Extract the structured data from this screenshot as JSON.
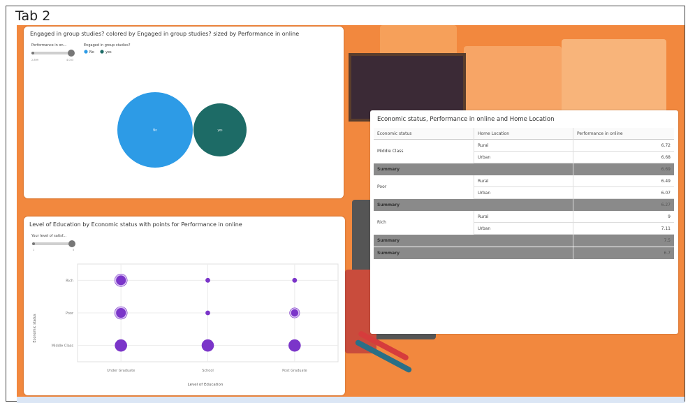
{
  "tab": {
    "title": "Tab 2"
  },
  "bubble_card": {
    "title": "Engaged in group studies? colored by Engaged in group studies? sized by Performance in online",
    "slider_label": "Performance in on...",
    "slider_min": "2.899",
    "slider_max": "4.033",
    "legend_title": "Engaged in group studies?",
    "legend": [
      {
        "label": "No",
        "color": "#2d9be6"
      },
      {
        "label": "yes",
        "color": "#1d6b66"
      }
    ],
    "bubbles": [
      {
        "label": "No",
        "color": "#2d9be6"
      },
      {
        "label": "yes",
        "color": "#1d6b66"
      }
    ]
  },
  "table_card": {
    "title": "Economic status, Performance in online and Home Location",
    "headers": [
      "Economic status",
      "Home Location",
      "Performance in online"
    ],
    "groups": [
      {
        "status": "Middle Class",
        "rows": [
          {
            "loc": "Rural",
            "val": "6.72"
          },
          {
            "loc": "Urban",
            "val": "6.68"
          }
        ],
        "summary_label": "Summary",
        "summary_val": "6.69"
      },
      {
        "status": "Poor",
        "rows": [
          {
            "loc": "Rural",
            "val": "6.49"
          },
          {
            "loc": "Urban",
            "val": "6.07"
          }
        ],
        "summary_label": "Summary",
        "summary_val": "6.27"
      },
      {
        "status": "Rich",
        "rows": [
          {
            "loc": "Rural",
            "val": "9"
          },
          {
            "loc": "Urban",
            "val": "7.11"
          }
        ],
        "summary_label": "Summary",
        "summary_val": "7.5"
      }
    ],
    "grand_summary_label": "Summary",
    "grand_summary_val": "6.7"
  },
  "scatter_card": {
    "title": "Level of Education by Economic status with points for Performance in online",
    "slider_label": "Your level of satisf...",
    "slider_min": "1",
    "slider_max": "5",
    "ylabel": "Economic status",
    "xlabel": "Level of Education"
  },
  "chart_data": [
    {
      "type": "bubble",
      "title": "Engaged in group studies? colored by Engaged in group studies? sized by Performance in online",
      "categories": [
        "No",
        "yes"
      ],
      "series": [
        {
          "name": "Engaged in group studies?",
          "values": [
            {
              "label": "No",
              "size_rank": 1
            },
            {
              "label": "yes",
              "size_rank": 2
            }
          ]
        }
      ]
    },
    {
      "type": "scatter",
      "title": "Level of Education by Economic status with points for Performance in online",
      "xlabel": "Level of Education",
      "ylabel": "Economic status",
      "x_categories": [
        "Under Graduate",
        "School",
        "Post Graduate"
      ],
      "y_categories": [
        "Middle Class",
        "Poor",
        "Rich"
      ],
      "points": [
        {
          "x": "Under Graduate",
          "y": "Rich",
          "size": 3
        },
        {
          "x": "School",
          "y": "Rich",
          "size": 1
        },
        {
          "x": "Post Graduate",
          "y": "Rich",
          "size": 1
        },
        {
          "x": "Under Graduate",
          "y": "Poor",
          "size": 3
        },
        {
          "x": "School",
          "y": "Poor",
          "size": 1
        },
        {
          "x": "Post Graduate",
          "y": "Poor",
          "size": 2
        },
        {
          "x": "Under Graduate",
          "y": "Middle Class",
          "size": 4
        },
        {
          "x": "School",
          "y": "Middle Class",
          "size": 4
        },
        {
          "x": "Post Graduate",
          "y": "Middle Class",
          "size": 4
        }
      ],
      "color": "#7b35c9",
      "grid": true
    }
  ]
}
